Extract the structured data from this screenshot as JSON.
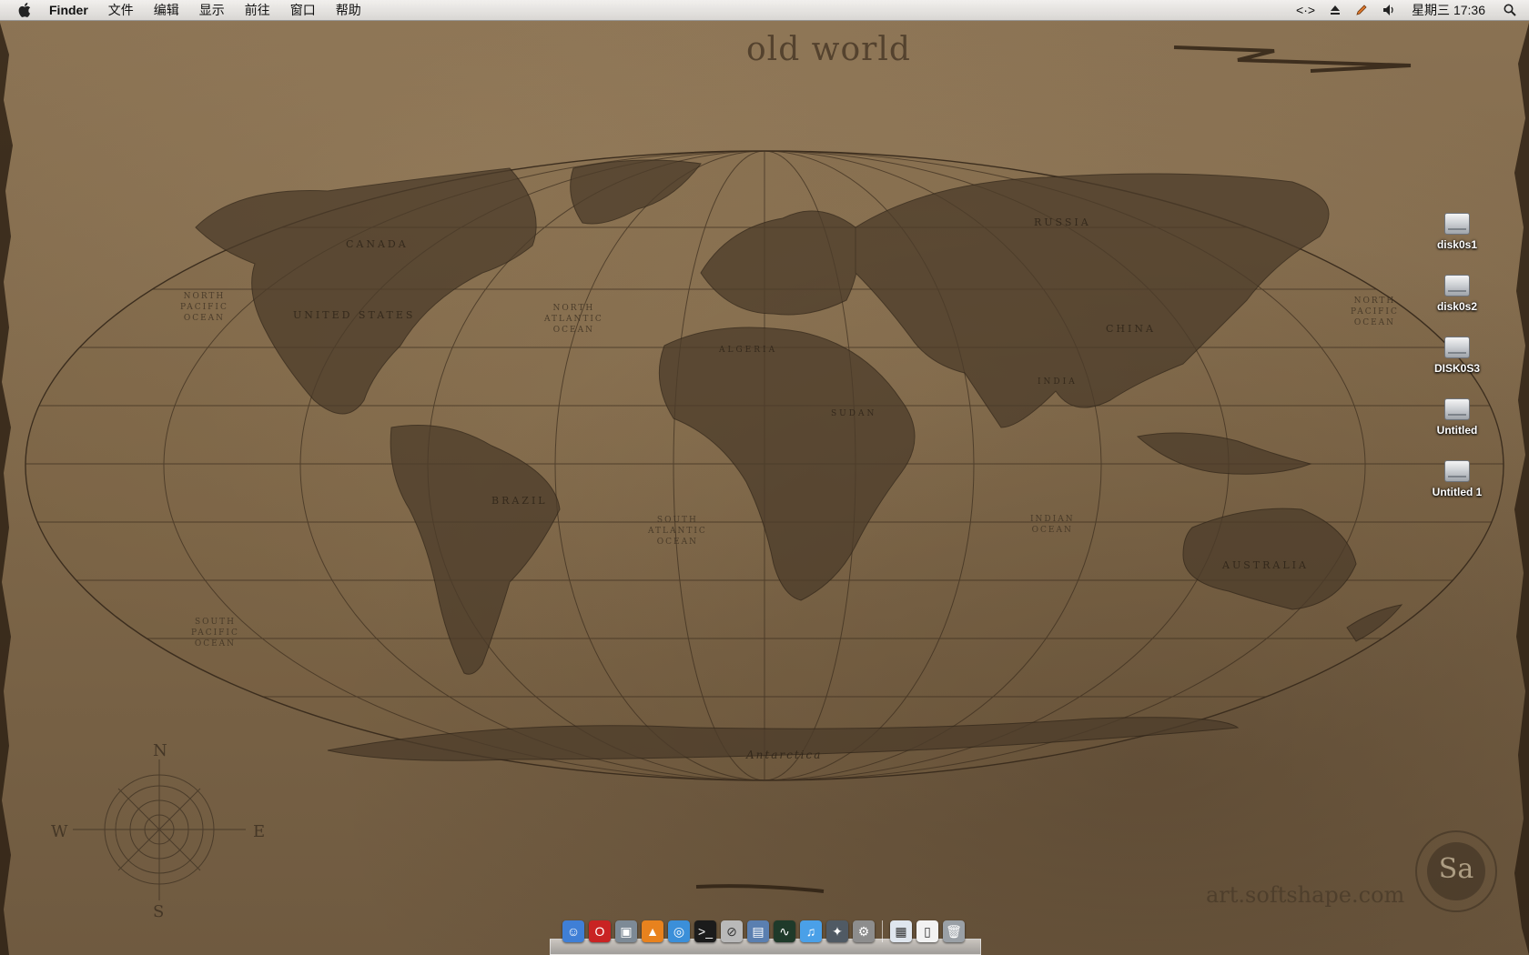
{
  "menubar": {
    "apple_icon": "apple-logo-icon",
    "app_name": "Finder",
    "menus": [
      "文件",
      "编辑",
      "显示",
      "前往",
      "窗口",
      "帮助"
    ],
    "status_icons": [
      "script-icon",
      "eject-icon",
      "pen-icon",
      "volume-icon"
    ],
    "script_glyph": "<·>",
    "clock": "星期三 17:36",
    "spotlight_icon": "spotlight-search-icon"
  },
  "wallpaper": {
    "title": "old world",
    "credit": "art.softshape.com",
    "continents": {
      "canada": "CANADA",
      "united_states": "UNITED STATES",
      "brazil": "BRAZIL",
      "russia": "RUSSIA",
      "china": "CHINA",
      "australia": "AUSTRALIA",
      "antarctica": "Antarctica",
      "india": "INDIA",
      "algeria": "ALGERIA",
      "sudan": "SUDAN"
    },
    "oceans": {
      "north_pacific": "NORTH\nPACIFIC\nOCEAN",
      "north_atlantic": "NORTH\nATLANTIC\nOCEAN",
      "south_atlantic": "SOUTH\nATLANTIC\nOCEAN",
      "south_pacific": "SOUTH\nPACIFIC\nOCEAN",
      "indian": "INDIAN\nOCEAN",
      "north_pacific_east": "NORTH\nPACIFIC\nOCEAN"
    },
    "compass": {
      "n": "N",
      "s": "S",
      "e": "E",
      "w": "W"
    },
    "seal_text": "Sa"
  },
  "desktop_icons": [
    {
      "label": "disk0s1",
      "icon": "external-drive-icon"
    },
    {
      "label": "disk0s2",
      "icon": "external-drive-icon"
    },
    {
      "label": "DISK0S3",
      "icon": "external-drive-icon"
    },
    {
      "label": "Untitled",
      "icon": "external-drive-icon"
    },
    {
      "label": "Untitled 1",
      "icon": "external-drive-icon"
    }
  ],
  "dock": {
    "apps": [
      {
        "name": "finder-icon",
        "glyph": "☺",
        "color": "#3f7fd6"
      },
      {
        "name": "opera-icon",
        "glyph": "O",
        "color": "#c92323"
      },
      {
        "name": "preview-icon",
        "glyph": "▣",
        "color": "#7d8a96"
      },
      {
        "name": "vlc-icon",
        "glyph": "▲",
        "color": "#e8821e"
      },
      {
        "name": "safari-icon",
        "glyph": "◎",
        "color": "#3b8fd9"
      },
      {
        "name": "terminal-icon",
        "glyph": ">_",
        "color": "#1b1b1b"
      },
      {
        "name": "no-entry-app-icon",
        "glyph": "⊘",
        "color": "#b9b9b9"
      },
      {
        "name": "photos-icon",
        "glyph": "▤",
        "color": "#5a7fb0"
      },
      {
        "name": "activity-monitor-icon",
        "glyph": "∿",
        "color": "#1f3a2a"
      },
      {
        "name": "itunes-icon",
        "glyph": "♫",
        "color": "#4aa0e8"
      },
      {
        "name": "utility-app-icon",
        "glyph": "✦",
        "color": "#505a64"
      },
      {
        "name": "system-preferences-icon",
        "glyph": "⚙",
        "color": "#8d8d8d"
      }
    ],
    "stacks": [
      {
        "name": "applications-stack-icon",
        "glyph": "▦",
        "color": "#dfe6ee"
      },
      {
        "name": "document-stack-icon",
        "glyph": "▯",
        "color": "#f2f2f2"
      },
      {
        "name": "trash-icon",
        "glyph": "🗑",
        "color": "#9aa0a6"
      }
    ]
  }
}
